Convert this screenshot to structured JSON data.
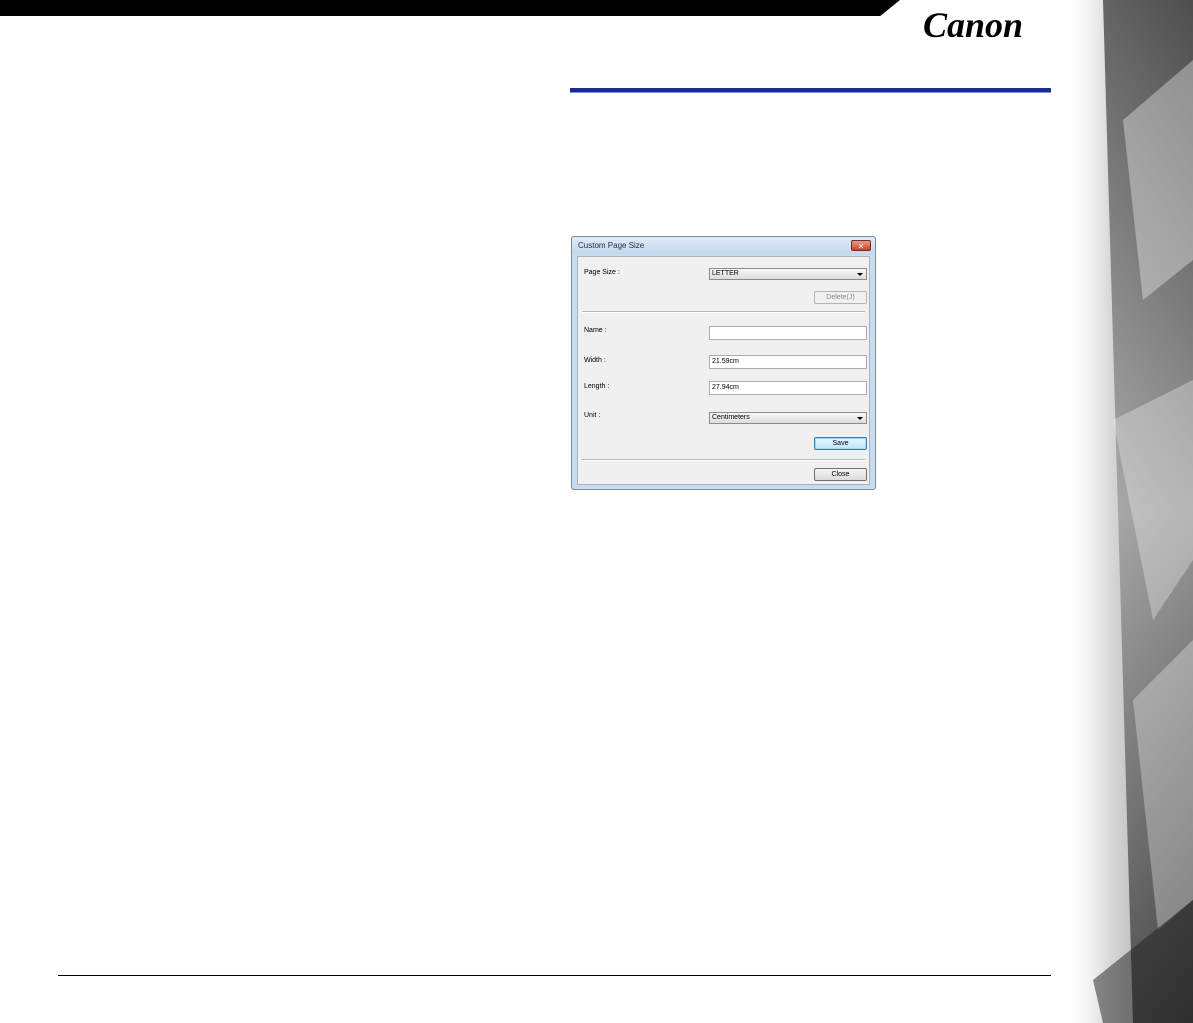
{
  "brand": {
    "logo_text": "Canon"
  },
  "dialog": {
    "title": "Custom Page Size",
    "close_glyph": "✕",
    "page_size": {
      "label": "Page Size :",
      "value": "LETTER"
    },
    "delete_button": "Delete(J)",
    "name": {
      "label": "Name :",
      "value": ""
    },
    "width": {
      "label": "Width :",
      "value": "21.59cm"
    },
    "length": {
      "label": "Length :",
      "value": "27.94cm"
    },
    "unit": {
      "label": "Unit :",
      "value": "Centimeters"
    },
    "save_button": "Save",
    "close_button": "Close"
  },
  "colors": {
    "title_rule": "#1a2a9a",
    "dialog_frame": "#c9dcef",
    "close_button": "#c7422d"
  }
}
